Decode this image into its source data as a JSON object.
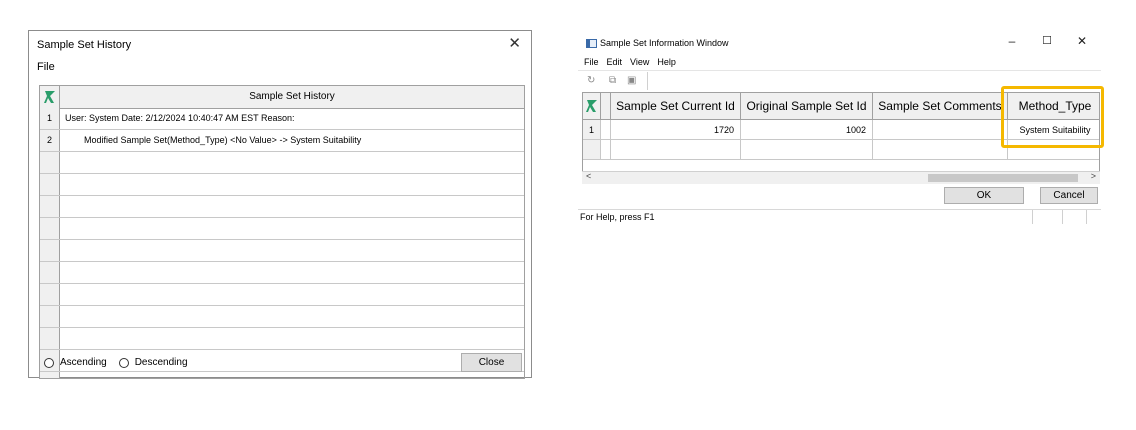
{
  "history_dialog": {
    "title": "Sample Set History",
    "close_glyph": "✕",
    "menu": [
      "File"
    ],
    "grid_header": "Sample Set History",
    "rows": [
      {
        "num": "1",
        "text": "User: System Date: 2/12/2024 10:40:47 AM EST  Reason:"
      },
      {
        "num": "2",
        "text": "Modified Sample Set(Method_Type) <No Value> -> System Suitability"
      }
    ],
    "radio_ascending": "Ascending",
    "radio_descending": "Descending",
    "close_button": "Close"
  },
  "info_window": {
    "title": "Sample Set Information Window",
    "controls": {
      "minimize": "–",
      "maximize": "☐",
      "close": "✕"
    },
    "menu": [
      "File",
      "Edit",
      "View",
      "Help"
    ],
    "toolbar_icons": [
      "refresh-icon",
      "copy-icon",
      "paste-icon"
    ],
    "columns": [
      "Sample Set Current Id",
      "Original Sample Set Id",
      "Sample Set Comments",
      "Method_Type"
    ],
    "rows": [
      {
        "num": "1",
        "current_id": "1720",
        "original_id": "1002",
        "comments": "",
        "method_type": "System Suitability"
      }
    ],
    "ok_button": "OK",
    "cancel_button": "Cancel",
    "status_text": "For Help, press F1"
  },
  "colors": {
    "highlight": "#f5b800",
    "grid_icon": "#2a9d6a"
  }
}
